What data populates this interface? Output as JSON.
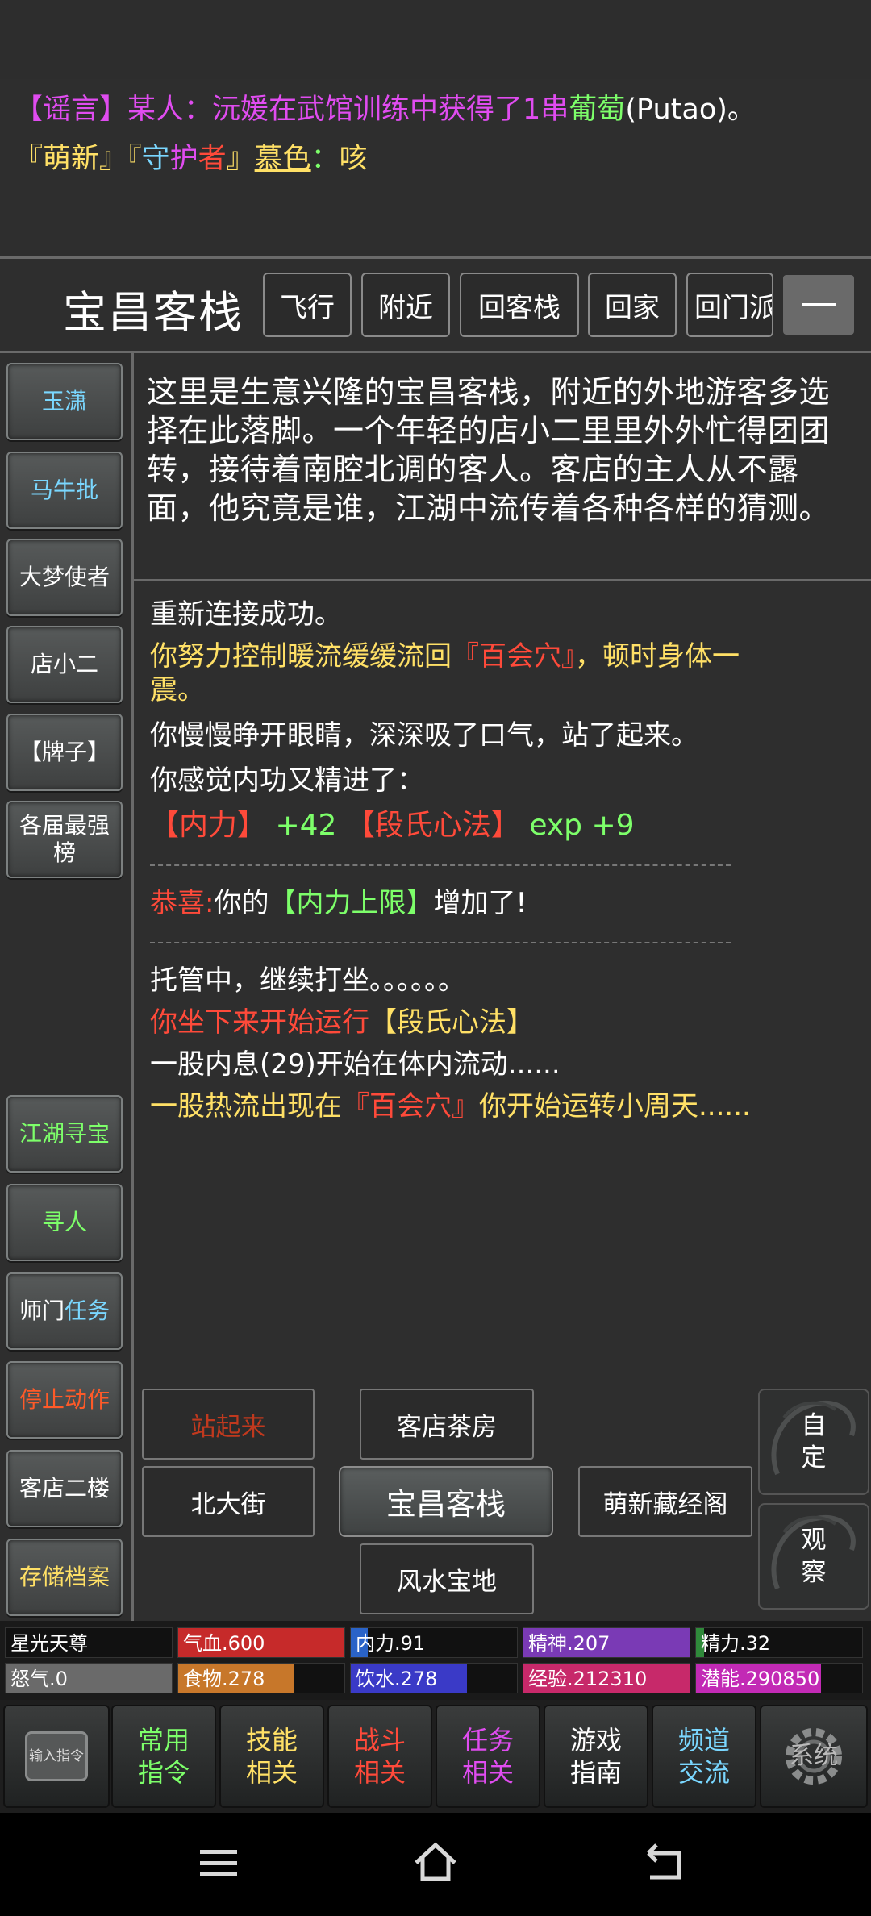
{
  "chat": {
    "line1": {
      "tag": "【谣言】",
      "speaker": "某人：",
      "msg": "沅媛在武馆训练中获得了1串",
      "item": "葡萄",
      "item_en": "(Putao)",
      "end": "。"
    },
    "line2": {
      "b1": "『",
      "t1": "萌新",
      "b2": "』『",
      "t2a": "守",
      "t2b": "护",
      "t2c": "者",
      "b3": "』",
      "name": "慕色",
      "colon": "：",
      "msg": "咳"
    }
  },
  "header": {
    "room": "宝昌客栈",
    "nav": [
      "飞行",
      "附近",
      "回客栈",
      "回家",
      "回门派"
    ],
    "collapse": "—"
  },
  "sidebar": {
    "top": [
      {
        "label": "玉潇",
        "color": "#7ad7ff"
      },
      {
        "label": "马牛批",
        "color": "#7ad7ff"
      },
      {
        "label": "大梦使者",
        "color": "#ffffff"
      },
      {
        "label": "店小二",
        "color": "#ffffff"
      },
      {
        "label": "【牌子】",
        "color": "#ffffff"
      },
      {
        "label": "各届最强榜",
        "color": "#ffffff"
      }
    ],
    "bottom": [
      {
        "label": "江湖寻宝",
        "color": "#7dff6a"
      },
      {
        "label": "寻人",
        "color": "#7dff6a"
      },
      {
        "label_a": "师门",
        "label_b": "任务"
      },
      {
        "label": "停止动作",
        "color": "#ff5a28"
      },
      {
        "label": "客店二楼",
        "color": "#ffffff"
      },
      {
        "label": "存储档案",
        "color": "#ffe066"
      }
    ]
  },
  "description": "这里是生意兴隆的宝昌客栈，附近的外地游客多选择在此落脚。一个年轻的店小二里里外外忙得团团转，接待着南腔北调的客人。客店的主人从不露面，他究竟是谁，江湖中流传着各种各样的猜测。",
  "messages": {
    "m1": "重新连接成功。",
    "m2a": "你努力控制暖流缓缓流回",
    "m2b": "『百会穴』",
    "m2c": "，顿时身体一",
    "m2d": "震。",
    "m3": "你慢慢睁开眼睛，深深吸了口气，站了起来。",
    "m4": "你感觉内功又精进了：",
    "m5a": "【内力】",
    "m5b": " +42 ",
    "m5c": "【段氏心法】",
    "m5d": " exp +9",
    "m6a": "恭喜:",
    "m6b": "你的",
    "m6c": "【内力上限】",
    "m6d": "增加了!",
    "m7": "托管中，继续打坐。。。。。。",
    "m8a": "你坐下来开始运行",
    "m8b": "【段氏心法】",
    "m9": "一股内息(29)开始在体内流动......",
    "m10a": "一股热流出现在",
    "m10b": "『百会穴』",
    "m10c": "你开始运转小周天......"
  },
  "exits": {
    "stand": "站起来",
    "north": "客店茶房",
    "west": "北大街",
    "center": "宝昌客栈",
    "east": "萌新藏经阁",
    "south": "风水宝地"
  },
  "controls": {
    "custom": "自\n定",
    "observe": "观\n察"
  },
  "stats": [
    {
      "label": "星光天尊",
      "fill": 0,
      "color": "#000000"
    },
    {
      "label": "气血.600",
      "fill": 1.0,
      "color": "#c62a2a"
    },
    {
      "label": "内力.91",
      "fill": 0.1,
      "color": "#2a63c7"
    },
    {
      "label": "精神.207",
      "fill": 1.0,
      "color": "#7a3ab5"
    },
    {
      "label": "精力.32",
      "fill": 0.05,
      "color": "#2f8a3a"
    },
    {
      "label": "怒气.0",
      "fill": 1.0,
      "color": "#6a6a6a"
    },
    {
      "label": "食物.278",
      "fill": 0.7,
      "color": "#c7772a"
    },
    {
      "label": "饮水.278",
      "fill": 0.7,
      "color": "#3a3ac7"
    },
    {
      "label": "经验.212310",
      "fill": 1.0,
      "color": "#c7296a"
    },
    {
      "label": "潜能.290850",
      "fill": 0.75,
      "color": "#c22ab5"
    }
  ],
  "menu": {
    "input": "输入指令",
    "items": [
      {
        "label": "常用\n指令",
        "color": "#7dff6a"
      },
      {
        "label": "技能\n相关",
        "color": "#ffe066"
      },
      {
        "label": "战斗\n相关",
        "color": "#ff4a3a"
      },
      {
        "label": "任务\n相关",
        "color": "#e04cf0"
      },
      {
        "label": "游戏\n指南",
        "color": "#ffffff"
      },
      {
        "label": "频道\n交流",
        "color": "#7ad7ff"
      }
    ],
    "system": "系统"
  }
}
